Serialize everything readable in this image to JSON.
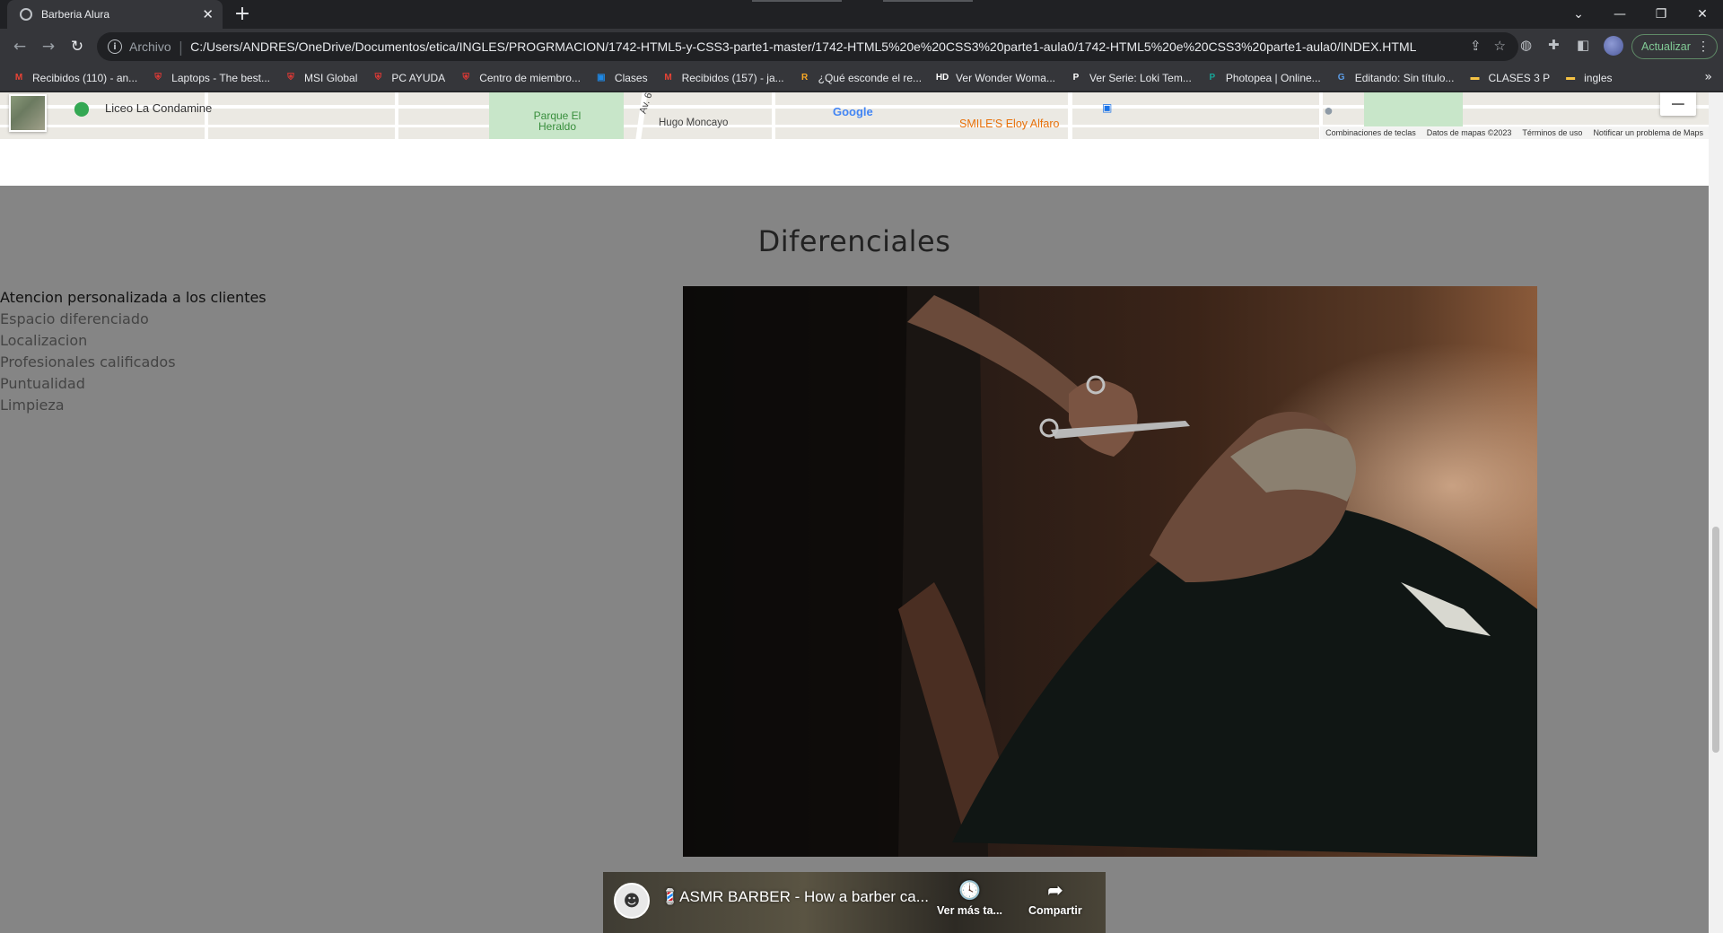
{
  "browser": {
    "tab_title": "Barberia Alura",
    "scheme_label": "Archivo",
    "url": "C:/Users/ANDRES/OneDrive/Documentos/etica/INGLES/PROGRMACION/1742-HTML5-y-CSS3-parte1-master/1742-HTML5%20e%20CSS3%20parte1-aula0/1742-HTML5%20e%20CSS3%20parte1-aula0/INDEX.HTML",
    "update_label": "Actualizar",
    "bookmarks": [
      {
        "label": "Recibidos (110) - an...",
        "icon": "gmail-icon",
        "color": "#ea4335"
      },
      {
        "label": "Laptops - The best...",
        "icon": "msi-shield-icon",
        "color": "#e53935"
      },
      {
        "label": "MSI Global",
        "icon": "msi-shield-icon",
        "color": "#e53935"
      },
      {
        "label": "PC AYUDA",
        "icon": "msi-shield-icon",
        "color": "#e53935"
      },
      {
        "label": "Centro de miembro...",
        "icon": "msi-shield-icon",
        "color": "#e53935"
      },
      {
        "label": "Clases",
        "icon": "classroom-icon",
        "color": "#1e88e5"
      },
      {
        "label": "Recibidos (157) - ja...",
        "icon": "gmail-icon",
        "color": "#ea4335"
      },
      {
        "label": "¿Qué esconde el re...",
        "icon": "r-icon",
        "color": "#f9a825"
      },
      {
        "label": "Ver Wonder Woma...",
        "icon": "hd-icon",
        "color": "#ffffff"
      },
      {
        "label": "Ver Serie: Loki Tem...",
        "icon": "p-icon",
        "color": "#ffffff"
      },
      {
        "label": "Photopea | Online...",
        "icon": "photopea-icon",
        "color": "#18a497"
      },
      {
        "label": "Editando: Sin título...",
        "icon": "editor-icon",
        "color": "#5c9ce6"
      },
      {
        "label": "CLASES 3 P",
        "icon": "folder-icon",
        "color": "#f6c344"
      },
      {
        "label": "ingles",
        "icon": "folder-icon",
        "color": "#f6c344"
      }
    ]
  },
  "map": {
    "labels": {
      "liceo": "Liceo La Condamine",
      "parque": "Parque El Heraldo",
      "hugo": "Hugo Moncayo",
      "smiles": "SMILE'S Eloy Alfaro",
      "avenida": "Av. 6",
      "google": "Google"
    },
    "footer": {
      "shortcuts": "Combinaciones de teclas",
      "data": "Datos de mapas ©2023",
      "terms": "Términos de uso",
      "report": "Notificar un problema de Maps"
    }
  },
  "section": {
    "title": "Diferenciales",
    "items": [
      "Atencion personalizada a los clientes",
      "Espacio diferenciado",
      "Localizacion",
      "Profesionales calificados",
      "Puntualidad",
      "Limpieza"
    ]
  },
  "video": {
    "title": "💈ASMR BARBER - How a barber ca...",
    "watch_later": "Ver más ta...",
    "share": "Compartir"
  },
  "colors": {
    "page_background": "#858585",
    "chrome_dark": "#202124",
    "chrome_toolbar": "#35363a",
    "update_green": "#81c995"
  }
}
